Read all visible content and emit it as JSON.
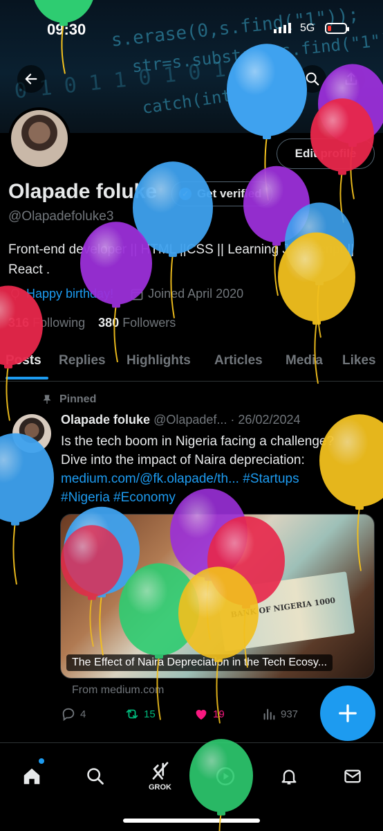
{
  "status_bar": {
    "time": "09:30",
    "network": "5G"
  },
  "banner": {
    "code_lines": [
      "s.erase(0,s.find(\"1\"));",
      "str=s.substr(0,s.find(\"1\"))",
      "0 1 0 1 1 0 1 0 1 1 0",
      "catch(int a)"
    ]
  },
  "header": {
    "edit_profile_label": "Edit profile",
    "display_name": "Olapade foluke",
    "get_verified_label": "Get verified",
    "handle": "@Olapadefoluke3",
    "bio": "Front-end developer || HTML ||CSS || Learning JavaScript || React .",
    "birthday_text": "Happy birthday!",
    "joined_text": "Joined April 2020",
    "following_count": "316",
    "following_label": "Following",
    "followers_count": "380",
    "followers_label": "Followers"
  },
  "tabs": [
    {
      "label": "Posts",
      "active": true
    },
    {
      "label": "Replies"
    },
    {
      "label": "Highlights"
    },
    {
      "label": "Articles"
    },
    {
      "label": "Media"
    },
    {
      "label": "Likes"
    }
  ],
  "tweet": {
    "pinned_label": "Pinned",
    "author_name": "Olapade foluke",
    "author_handle": "@Olapadef...",
    "date": "· 26/02/2024",
    "text_line1": "Is the tech boom in Nigeria facing a challenge?",
    "text_line2": "Dive into the impact of Naira depreciation:",
    "link": "medium.com/@fk.olapade/th...",
    "hashtag1": "#Startups",
    "hashtag2": "#Nigeria",
    "hashtag3": "#Economy",
    "card_caption": "The Effect of Naira Depreciation in the Tech Ecosy...",
    "card_image_text": "BANK OF NIGERIA 1000",
    "card_source": "From medium.com",
    "replies": "4",
    "reposts": "15",
    "likes": "19",
    "views": "937"
  },
  "bottom_nav": {
    "grok_label": "GROK"
  },
  "colors": {
    "accent": "#1d9bf0",
    "repost_green": "#00ba7c",
    "like_pink": "#f91880",
    "muted": "#71767b"
  }
}
